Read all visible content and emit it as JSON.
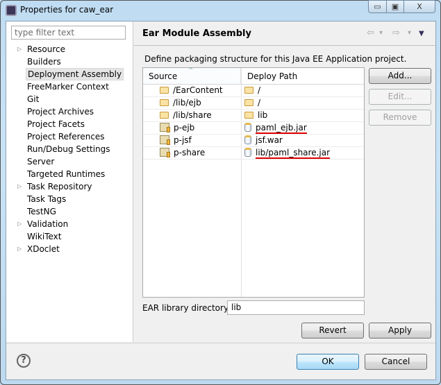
{
  "window": {
    "title": "Properties for caw_ear",
    "controls": {
      "minimize": "▭",
      "maximize": "▣",
      "close": "X"
    }
  },
  "filter": {
    "placeholder": "type filter text"
  },
  "sidebar": {
    "items": [
      {
        "label": "Resource",
        "expandable": true
      },
      {
        "label": "Builders",
        "expandable": false
      },
      {
        "label": "Deployment Assembly",
        "expandable": false,
        "selected": true
      },
      {
        "label": "FreeMarker Context",
        "expandable": false
      },
      {
        "label": "Git",
        "expandable": false
      },
      {
        "label": "Project Archives",
        "expandable": false
      },
      {
        "label": "Project Facets",
        "expandable": false
      },
      {
        "label": "Project References",
        "expandable": false
      },
      {
        "label": "Run/Debug Settings",
        "expandable": false
      },
      {
        "label": "Server",
        "expandable": false
      },
      {
        "label": "Targeted Runtimes",
        "expandable": false
      },
      {
        "label": "Task Repository",
        "expandable": true
      },
      {
        "label": "Task Tags",
        "expandable": false
      },
      {
        "label": "TestNG",
        "expandable": false
      },
      {
        "label": "Validation",
        "expandable": true
      },
      {
        "label": "WikiText",
        "expandable": false
      },
      {
        "label": "XDoclet",
        "expandable": true
      }
    ]
  },
  "page": {
    "title": "Ear Module Assembly",
    "nav": {
      "back": "⇦",
      "forward": "⇨",
      "dropdown": "▾",
      "menu": "▼"
    },
    "description": "Define packaging structure for this Java EE Application project."
  },
  "table": {
    "columns": [
      "Source",
      "Deploy Path"
    ],
    "sort_indicator": "^",
    "rows": [
      {
        "source": "/EarContent",
        "source_icon": "folder",
        "path": "/",
        "path_icon": "folder"
      },
      {
        "source": "/lib/ejb",
        "source_icon": "folder",
        "path": "/",
        "path_icon": "folder"
      },
      {
        "source": "/lib/share",
        "source_icon": "folder",
        "path": "lib",
        "path_icon": "folder"
      },
      {
        "source": "p-ejb",
        "source_icon": "project",
        "path": "paml_ejb.jar",
        "path_icon": "jar",
        "underlined": true
      },
      {
        "source": "p-jsf",
        "source_icon": "project",
        "path": "jsf.war",
        "path_icon": "jar"
      },
      {
        "source": "p-share",
        "source_icon": "project",
        "path": "lib/paml_share.jar",
        "path_icon": "jar",
        "underlined": true
      }
    ]
  },
  "buttons": {
    "add": "Add...",
    "edit": "Edit...",
    "remove": "Remove",
    "revert": "Revert",
    "apply": "Apply",
    "ok": "OK",
    "cancel": "Cancel",
    "help": "?"
  },
  "ear_lib": {
    "label": "EAR library directory:",
    "value": "lib"
  },
  "colors": {
    "annotation": "#e00000"
  }
}
